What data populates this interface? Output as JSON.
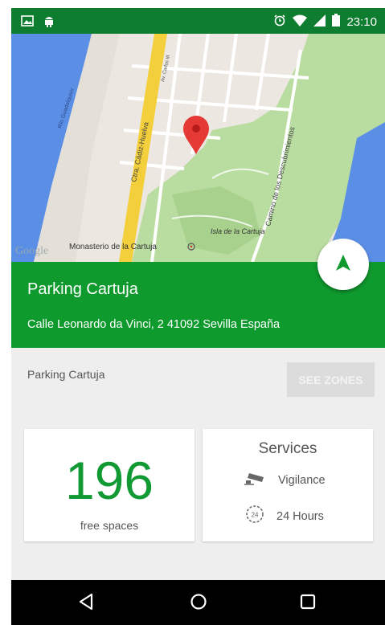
{
  "status_bar": {
    "time": "23:10",
    "icons": [
      "image-notification-icon",
      "android-notification-icon",
      "alarm-icon",
      "wifi-icon",
      "signal-icon",
      "battery-icon"
    ]
  },
  "map": {
    "labels": {
      "road_main": "Ctra. Cádiz-Huelva",
      "road_carlos": "Av. Carlos III",
      "river": "Río Guadalquivir",
      "camino": "Camino de los Descubrimientos",
      "isla": "Isla de la Cartuja",
      "monasterio": "Monasterio de la Cartuja",
      "google": "Google"
    },
    "colors": {
      "water": "#5b8fe6",
      "park": "#b9dca0",
      "urban": "#ece8e1",
      "road": "#f3cf3c"
    }
  },
  "header": {
    "title": "Parking Cartuja",
    "address": "Calle Leonardo da Vinci, 2 41092 Sevilla España",
    "color": "#0f9a2e"
  },
  "info": {
    "name": "Parking Cartuja",
    "see_zones_label": "SEE ZONES"
  },
  "free_card": {
    "count": "196",
    "label": "free spaces"
  },
  "services_card": {
    "title": "Services",
    "items": [
      {
        "label": "Vigilance",
        "icon": "security-camera-icon"
      },
      {
        "label": "24 Hours",
        "icon": "clock-24h-icon"
      }
    ]
  },
  "nav_bar": {
    "buttons": [
      "back-icon",
      "home-icon",
      "recents-icon"
    ]
  }
}
